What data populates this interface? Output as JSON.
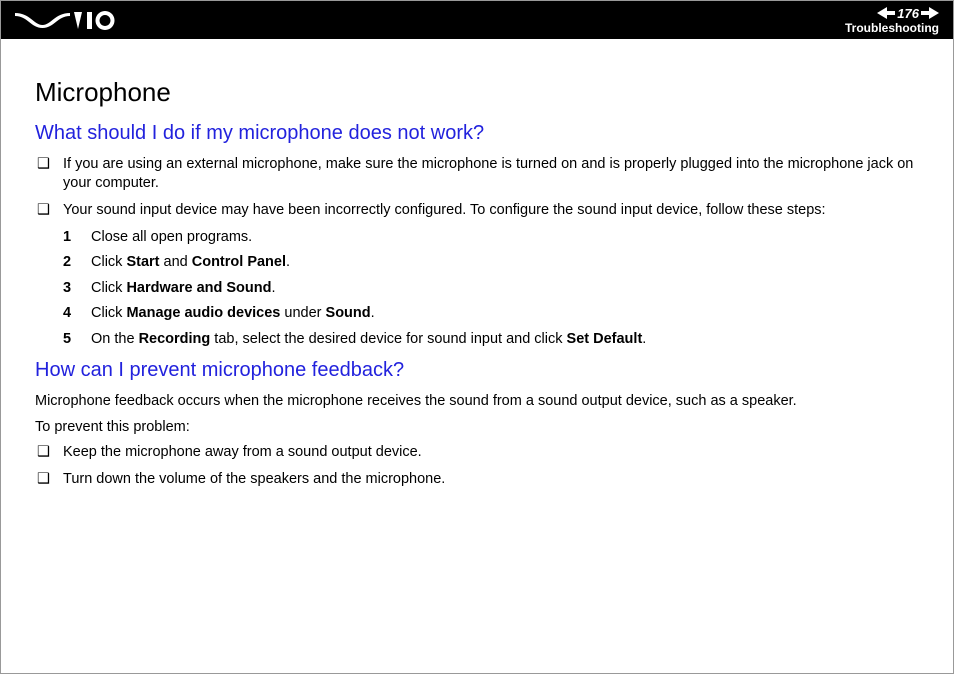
{
  "header": {
    "page_number": "176",
    "breadcrumb": "Troubleshooting"
  },
  "main": {
    "title": "Microphone",
    "section1": {
      "heading": "What should I do if my microphone does not work?",
      "bullet1": "If you are using an external microphone, make sure the microphone is turned on and is properly plugged into the microphone jack on your computer.",
      "bullet2": "Your sound input device may have been incorrectly configured. To configure the sound input device, follow these steps:",
      "steps": {
        "s1": {
          "pre": "Close all open programs."
        },
        "s2": {
          "pre": "Click ",
          "b1": "Start",
          "mid": " and ",
          "b2": "Control Panel",
          "post": "."
        },
        "s3": {
          "pre": "Click ",
          "b1": "Hardware and Sound",
          "post": "."
        },
        "s4": {
          "pre": "Click ",
          "b1": "Manage audio devices",
          "mid": " under ",
          "b2": "Sound",
          "post": "."
        },
        "s5": {
          "pre": "On the ",
          "b1": "Recording",
          "mid": " tab, select the desired device for sound input and click ",
          "b2": "Set Default",
          "post": "."
        }
      }
    },
    "section2": {
      "heading": "How can I prevent microphone feedback?",
      "para1": "Microphone feedback occurs when the microphone receives the sound from a sound output device, such as a speaker.",
      "para2": "To prevent this problem:",
      "bullet1": "Keep the microphone away from a sound output device.",
      "bullet2": "Turn down the volume of the speakers and the microphone."
    }
  }
}
